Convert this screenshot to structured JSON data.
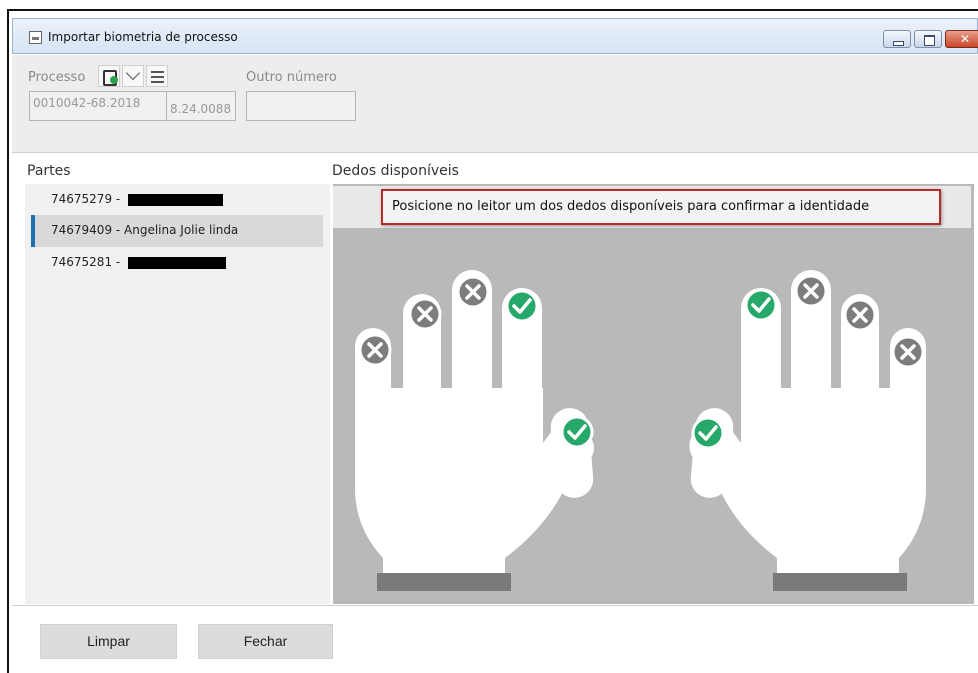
{
  "window": {
    "title": "Importar biometria de processo"
  },
  "form": {
    "processo_label": "Processo",
    "outro_numero_label": "Outro número",
    "processo_value_1": "0010042-68.2018",
    "processo_value_2": "8.24.0088",
    "outro_numero_value": ""
  },
  "parts": {
    "label": "Partes",
    "items": [
      {
        "id": "74675279 -",
        "name": ""
      },
      {
        "id": "74679409 - Angelina Jolie linda",
        "name": ""
      },
      {
        "id": "74675281 -",
        "name": ""
      }
    ]
  },
  "fingers": {
    "label": "Dedos disponíveis",
    "instruction": "Posicione no leitor um dos dedos disponíveis para confirmar a identidade",
    "left_hand": [
      "unavailable",
      "unavailable",
      "unavailable",
      "available",
      "available"
    ],
    "right_hand": [
      "available",
      "available",
      "unavailable",
      "unavailable",
      "unavailable"
    ],
    "colors": {
      "available": "#27a86b",
      "unavailable": "#7d7d7d"
    }
  },
  "buttons": {
    "clear": "Limpar",
    "close": "Fechar"
  }
}
